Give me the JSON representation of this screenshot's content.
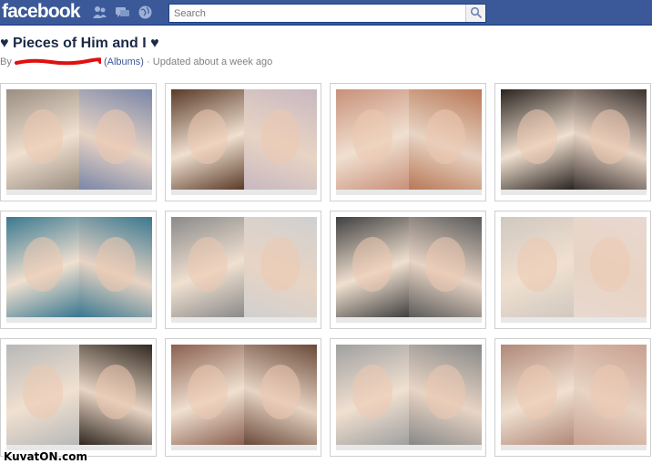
{
  "header": {
    "logo": "facebook",
    "search_placeholder": "Search",
    "brand_color": "#3b5998",
    "icons": [
      "friend-requests-icon",
      "messages-icon",
      "notifications-globe-icon",
      "search-icon"
    ]
  },
  "album": {
    "title": "♥ Pieces of Him and I ♥",
    "by_prefix": "By",
    "albums_link": "(Albums)",
    "updated": "· Updated about a week ago"
  },
  "photos": [
    {
      "left": "#9a8e82",
      "right": "#7a86a8"
    },
    {
      "left": "#5a3a28",
      "right": "#c8b8c0"
    },
    {
      "left": "#c8907a",
      "right": "#b87856"
    },
    {
      "left": "#2a2420",
      "right": "#3a3230"
    },
    {
      "left": "#3a7890",
      "right": "#3a7890"
    },
    {
      "left": "#8a8a8a",
      "right": "#d0d0d0"
    },
    {
      "left": "#404040",
      "right": "#5a5a5a"
    },
    {
      "left": "#d0c8c0",
      "right": "#e8d8d0"
    },
    {
      "left": "#b8b8b8",
      "right": "#302820"
    },
    {
      "left": "#8a6050",
      "right": "#6a4a3a"
    },
    {
      "left": "#a0a0a0",
      "right": "#888888"
    },
    {
      "left": "#b08878",
      "right": "#c8a090"
    }
  ],
  "watermark": "KuvatON.com"
}
